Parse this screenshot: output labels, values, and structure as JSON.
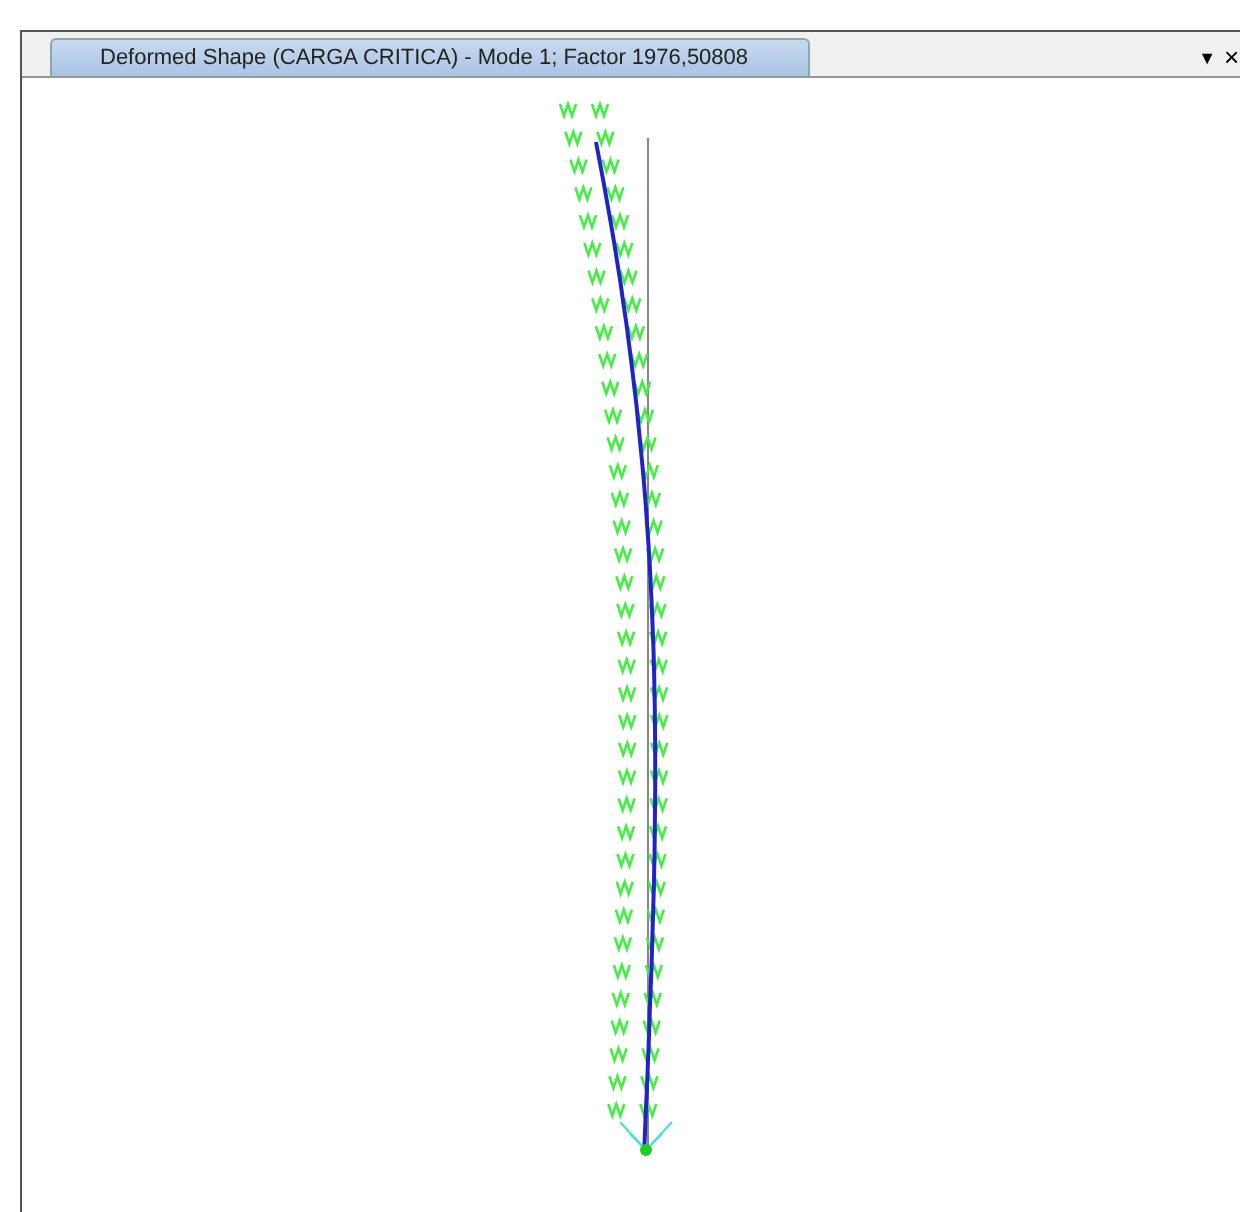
{
  "tab": {
    "title": "Deformed Shape (CARGA CRITICA) - Mode 1; Factor 1976,50808",
    "selected": true
  },
  "tab_controls": [
    {
      "label": "▼"
    },
    {
      "label": "×"
    }
  ]
}
